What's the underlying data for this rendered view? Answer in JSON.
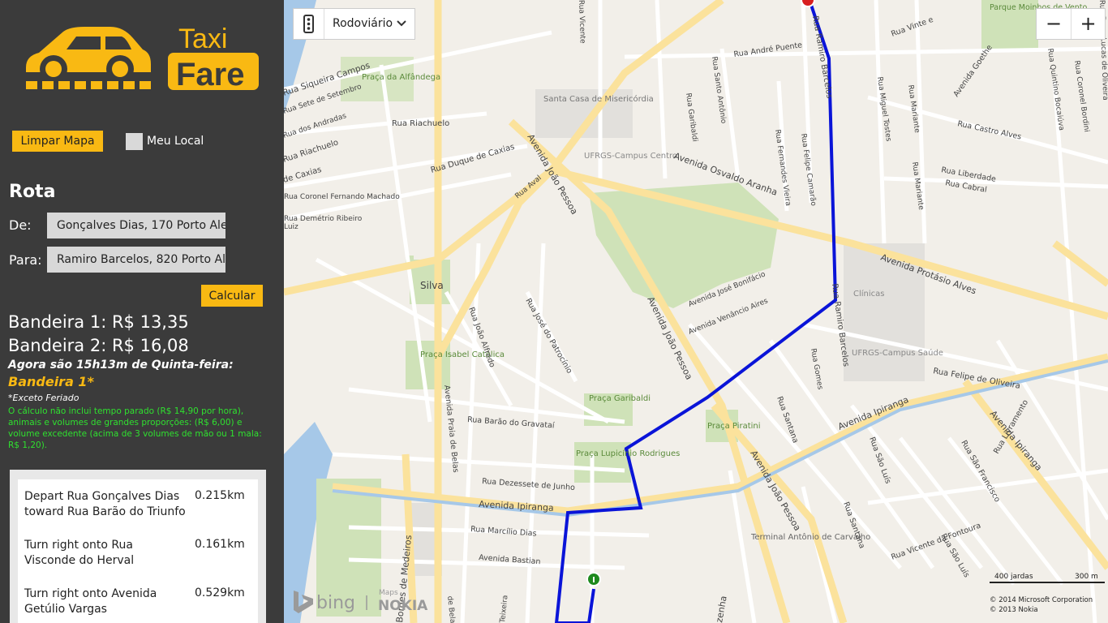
{
  "app": {
    "logo_word_top": "Taxi",
    "logo_word_bottom": "Fare",
    "accent": "#f9b913"
  },
  "controls": {
    "clear_map_label": "Limpar Mapa",
    "my_location_label": "Meu Local",
    "calculate_label": "Calcular"
  },
  "route": {
    "heading": "Rota",
    "from_label": "De:",
    "from_value": "Gonçalves Dias, 170 Porto Alegre",
    "to_label": "Para:",
    "to_value": "Ramiro Barcelos, 820 Porto Alegre"
  },
  "fares": {
    "flag1": "Bandeira 1: R$ 13,35",
    "flag2": "Bandeira 2: R$ 16,08",
    "now_text": "Agora são 15h13m de Quinta-feira:",
    "current_flag": "Bandeira 1*",
    "exception": "*Exceto Feriado",
    "note": "O cálculo não inclui tempo parado (R$ 14,90 por hora), animais e volumes de grandes proporções: (R$ 6,00) e volume excedente (acima de 3 volumes de mão ou 1 mala: R$ 1,20)."
  },
  "directions": [
    {
      "text": "Depart Rua Gonçalves Dias toward Rua Barão do Triunfo",
      "distance": "0.215km"
    },
    {
      "text": "Turn right onto Rua Visconde do Herval",
      "distance": "0.161km"
    },
    {
      "text": "Turn right onto Avenida Getúlio Vargas",
      "distance": "0.529km"
    }
  ],
  "map": {
    "style_label": "Rodoviário",
    "zoom_out": "−",
    "zoom_in": "+",
    "scale_yards": "400 jardas",
    "scale_meters": "300 m",
    "copyright1": "© 2014 Microsoft Corporation",
    "copyright2": "© 2013 Nokia",
    "brand_bing": "bing",
    "brand_maps": "Maps",
    "brand_nokia": "NOKIA",
    "start_pin": "I",
    "route_color": "#0a14d8",
    "labels": {
      "siqueira": "Rua Siqueira Campos",
      "praca_alfandega": "Praça da Alfândega",
      "sete_setembro": "Rua Sete de Setembro",
      "andradas": "Rua dos Andradas",
      "riachuelo": "Rua Riachuelo",
      "riachuelo2": "Rua Riachuelo",
      "caxias": "Rua Duque de Caxias",
      "caxias2": "de Caxias",
      "caxias3": "Rua Duque de Caxias",
      "fernando": "Rua Coronel Fernando Machado",
      "demetrio": "Rua Demétrio Ribeiro",
      "luiz": "Luiz",
      "santa_casa": "Santa Casa de Misericórdia",
      "ufrgs_centro": "UFRGS-Campus Centro",
      "silva": "Silva",
      "joao_pessoa": "Avenida João Pessoa",
      "joao_pessoa2": "Avenida João Pessoa",
      "joao_pessoa3": "Avenida João Pessoa",
      "aval": "Rua Aval",
      "osvaldo": "Avenida Osvaldo Aranha",
      "protasio": "Avenida Protásio Alves",
      "clinicas": "Clínicas",
      "ufrgs_saude": "UFRGS-Campus Saúde",
      "felipe": "Rua Felipe de Oliveira",
      "ipiranga": "Avenida Ipiranga",
      "ipiranga2": "Avenida Ipiranga",
      "ipiranga3": "Avenida Ipiranga",
      "isabel": "Praça Isabel Católica",
      "garibaldi": "Praça Garibaldi",
      "lupicinio": "Praça Lupicínio Rodrigues",
      "piratini": "Praça Piratini",
      "gravatai": "Rua Barão do Gravataí",
      "dezessete": "Rua Dezessete de Junho",
      "marcilio": "Rua Marcílio Dias",
      "bastian": "Avenida Bastian",
      "terminal": "Terminal Antônio de Carvalho",
      "ramiro": "Rua Ramiro Barcelos",
      "ramiro2": "Rua Ramiro Barcelos",
      "andre_puente": "Rua André Puente",
      "castro_alves": "Rua Castro Alves",
      "liberdade": "Rua Liberdade",
      "cabral": "Rua Cabral",
      "goethe": "Avenida Goethe",
      "santana": "Rua Santana",
      "santana2": "Rua Santana",
      "vicente": "Rua Vicente da Fontoura",
      "moinhos": "Parque Moinhos de Vento",
      "jose_bonifacio": "Avenida José Bonifácio",
      "venancio": "Avenida Venâncio Aires",
      "patrocinio": "Rua José do Patrocínio",
      "joao_alfredo": "Rua João Alfredo",
      "praia_belas": "Avenida Praia de Belas",
      "borges": "Borges de Medeiros",
      "sao_luis": "Rua São Luís",
      "sao_luis2": "Rua São Luís",
      "sao_francisco": "Rua São Francisco",
      "livramento": "Rua Livramento",
      "vinte": "Rua Vinte e",
      "fernandes_vieira": "Rua Fernandes Vieira",
      "felipe_camarao": "Rua Felipe Camarão",
      "santo_antonio": "Rua Santo Antônio",
      "garibaldi_st": "Rua Garibaldi",
      "miguel": "Rua Miguel Tostes",
      "mariante": "Rua Mariante",
      "mariante2": "Rua Mariante",
      "bento": "Rua Vicente",
      "quintino": "Rua Quintino Bocaiúva",
      "bordini": "Rua Coronel Bordini",
      "lucas": "Rua Dona Lucas de Oliveira",
      "gomes": "Rua Gomes",
      "teixeira": "Teixeira",
      "belas": "de Belas",
      "zenha": "zenha"
    }
  }
}
